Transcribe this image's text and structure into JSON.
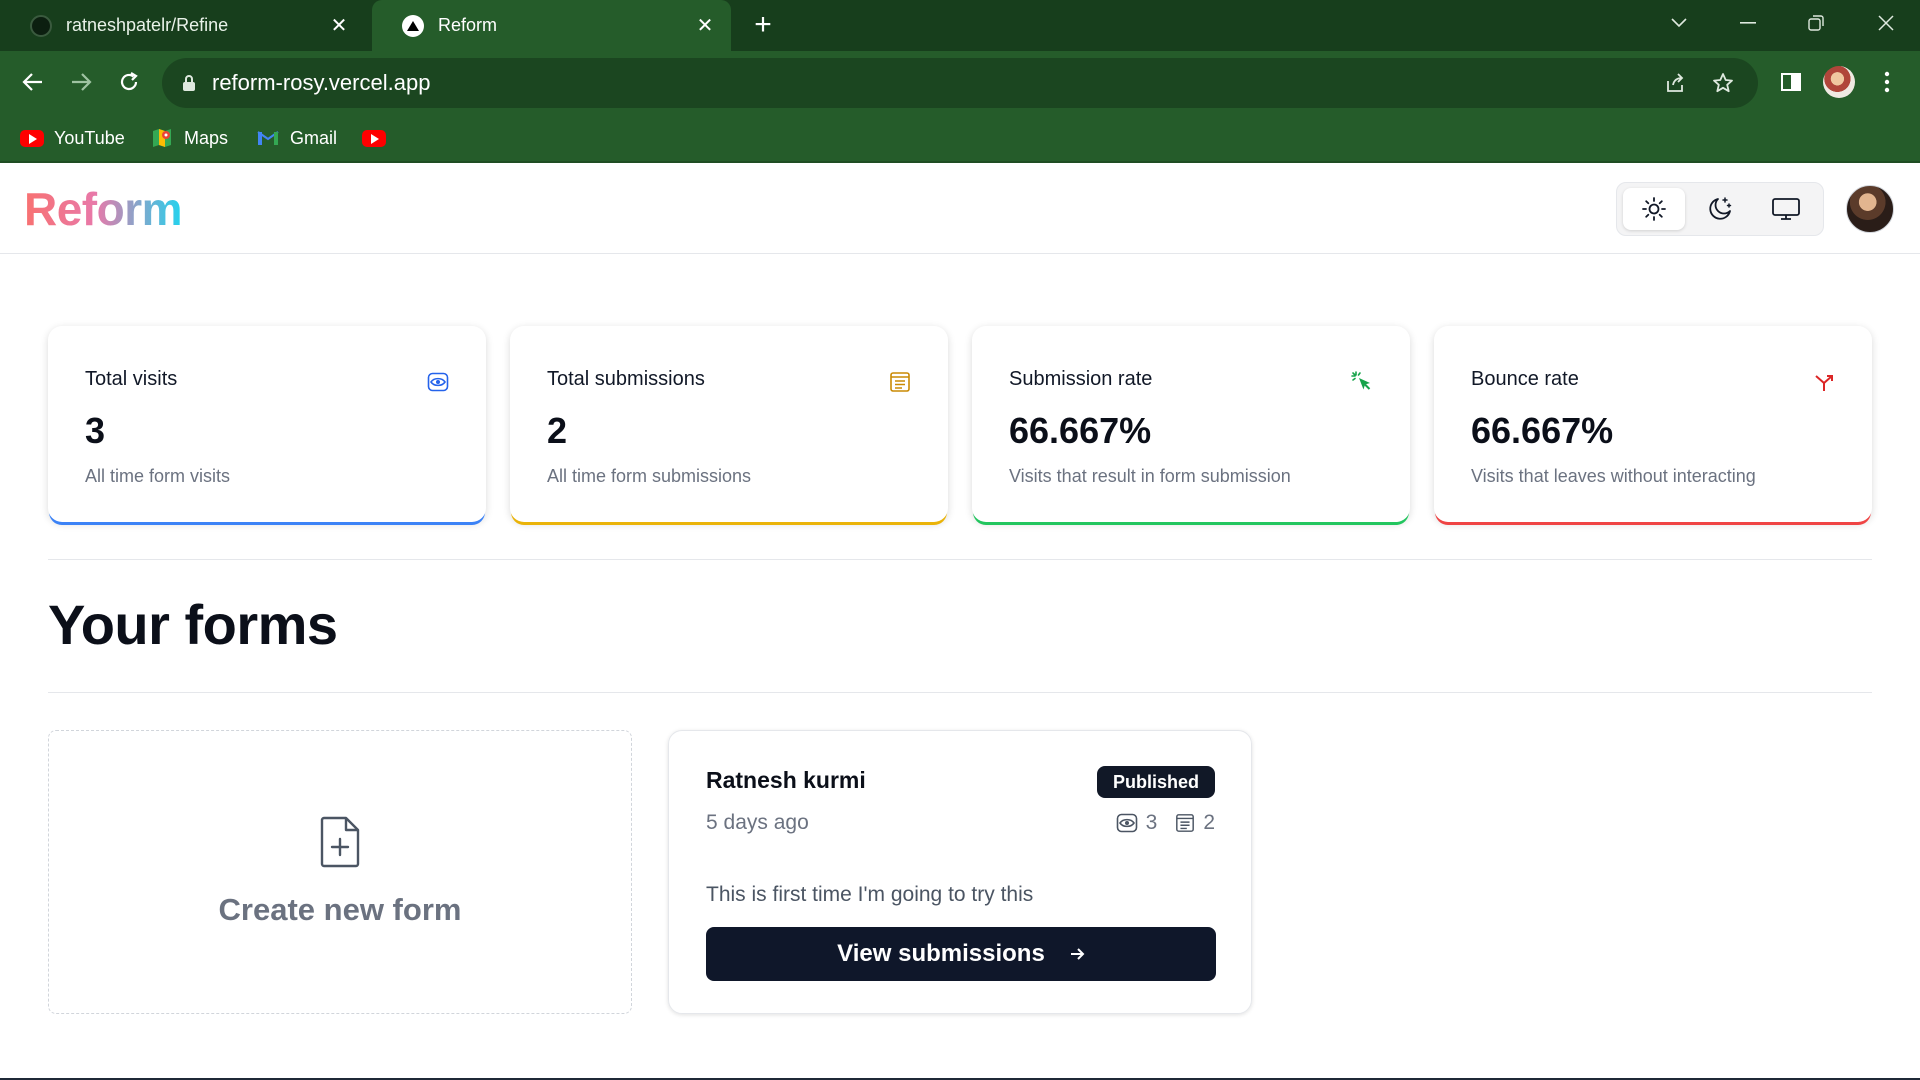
{
  "browser": {
    "tabs": [
      {
        "title": "ratneshpatelr/Refine",
        "active": false
      },
      {
        "title": "Reform",
        "active": true
      }
    ],
    "url": "reform-rosy.vercel.app",
    "bookmarks": [
      {
        "label": "YouTube",
        "icon": "youtube-icon"
      },
      {
        "label": "Maps",
        "icon": "maps-icon"
      },
      {
        "label": "Gmail",
        "icon": "gmail-icon"
      },
      {
        "label": "",
        "icon": "youtube-icon"
      }
    ],
    "colors": {
      "frame": "#173e1c",
      "toolbar": "#255c2a",
      "omnibox": "#1b4620"
    }
  },
  "app": {
    "logo": "Reform",
    "theme_modes": [
      "light",
      "dark",
      "system"
    ],
    "active_theme": "light"
  },
  "stats": [
    {
      "title": "Total visits",
      "value": "3",
      "help": "All time form visits",
      "icon": "eye-icon",
      "accent": "#3b82f6"
    },
    {
      "title": "Total submissions",
      "value": "2",
      "help": "All time form submissions",
      "icon": "form-icon",
      "accent": "#eab308"
    },
    {
      "title": "Submission rate",
      "value": "66.667%",
      "help": "Visits that result in form submission",
      "icon": "cursor-click-icon",
      "accent": "#22c55e"
    },
    {
      "title": "Bounce rate",
      "value": "66.667%",
      "help": "Visits that leaves without interacting",
      "icon": "split-arrow-icon",
      "accent": "#ef4444"
    }
  ],
  "section_title": "Your forms",
  "create_form": {
    "label": "Create new form",
    "icon": "file-plus-icon"
  },
  "forms": [
    {
      "name": "Ratnesh kurmi",
      "status": "Published",
      "created": "5 days ago",
      "visits": "3",
      "submissions": "2",
      "description": "This is first time I'm going to try this",
      "button": "View submissions"
    }
  ]
}
